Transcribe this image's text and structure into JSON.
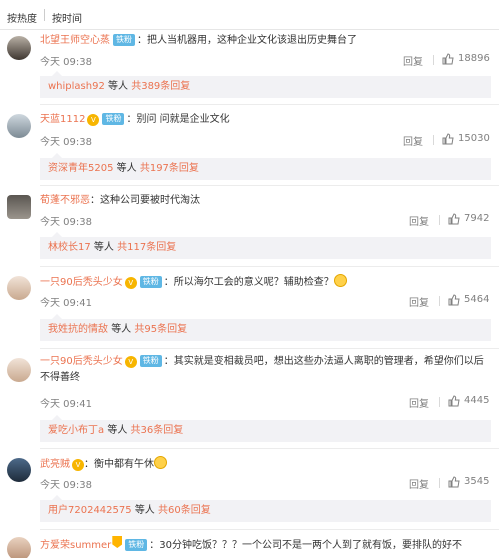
{
  "sort": {
    "hot": "按热度",
    "time": "按时间"
  },
  "labels": {
    "fan_badge": "铁粉",
    "reply": "回复",
    "sub_mid": "等人",
    "sub_suffix": "条回复"
  },
  "comments": [
    {
      "name": "北望王师空心蒸",
      "badge": true,
      "vip": false,
      "medal": false,
      "text": "：把人当机器用，这种企业文化该退出历史舞台了",
      "time": "今天 09:38",
      "likes": "18896",
      "sub_user": "whiplash92",
      "sub_count_text": "共389条回复"
    },
    {
      "name": "天蓝1112",
      "badge": true,
      "vip": true,
      "medal": false,
      "text": "：别问 问就是企业文化",
      "time": "今天 09:38",
      "likes": "15030",
      "sub_user": "资深青年5205",
      "sub_count_text": "共197条回复"
    },
    {
      "name": "荀蓬不邪恶",
      "badge": false,
      "vip": false,
      "medal": false,
      "text": "：这种公司要被时代淘汰",
      "time": "今天 09:38",
      "likes": "7942",
      "sub_user": "林校长17",
      "sub_count_text": "共117条回复"
    },
    {
      "name": "一只90后秃头少女",
      "badge": true,
      "vip": true,
      "medal": false,
      "text": "：所以海尔工会的意义呢？辅助检查？",
      "emoji_after": true,
      "time": "今天 09:41",
      "likes": "5464",
      "sub_user": "我姓抗的情敌",
      "sub_count_text": "共95条回复"
    },
    {
      "name": "一只90后秃头少女",
      "badge": true,
      "vip": true,
      "medal": false,
      "text": "：其实就是变相裁员吧，想出这些办法逼人离职的管理者，希望你们以后不得善终",
      "time": "今天 09:41",
      "likes": "4445",
      "sub_user": "爱吃小布丁a",
      "sub_count_text": "共36条回复"
    },
    {
      "name": "武亮贼",
      "badge": false,
      "vip": true,
      "medal": false,
      "text": "：衡中都有午休",
      "emoji_after": true,
      "time": "今天 09:38",
      "likes": "3545",
      "sub_user": "用户7202442575",
      "sub_count_text": "共60条回复"
    },
    {
      "name": "方爱荣summer",
      "badge": true,
      "vip": false,
      "medal": true,
      "text": "：30分钟吃饭？？？一个公司不是一两个人到了就有饭，要排队的好不"
    }
  ],
  "colors": {
    "name": "#eb7350",
    "badge": "#5fb7e4",
    "meta": "#808080",
    "subbg": "#f2f2f5"
  }
}
